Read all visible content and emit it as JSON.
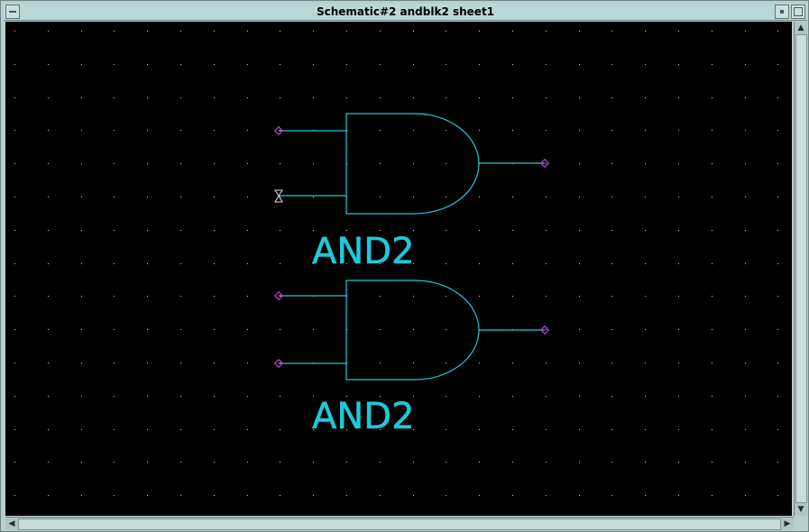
{
  "window": {
    "title": "Schematic#2 andblk2 sheet1",
    "buttons": {
      "menu": "window-menu-icon",
      "minimize": "minimize-icon",
      "maximize": "maximize-icon"
    }
  },
  "colors": {
    "canvas_bg": "#000000",
    "grid_dot": "#cfcfcf",
    "wire": "#1fc8d8",
    "pin": "#c83cc8",
    "label": "#1fc8d8"
  },
  "schematic": {
    "gates": [
      {
        "type": "AND2",
        "label": "AND2",
        "inputs": 2,
        "outputs": 1
      },
      {
        "type": "AND2",
        "label": "AND2",
        "inputs": 2,
        "outputs": 1
      }
    ]
  },
  "scrollbars": {
    "vertical": {
      "up": "arrow-up-icon",
      "down": "arrow-down-icon"
    },
    "horizontal": {
      "left": "arrow-left-icon",
      "right": "arrow-right-icon"
    }
  }
}
